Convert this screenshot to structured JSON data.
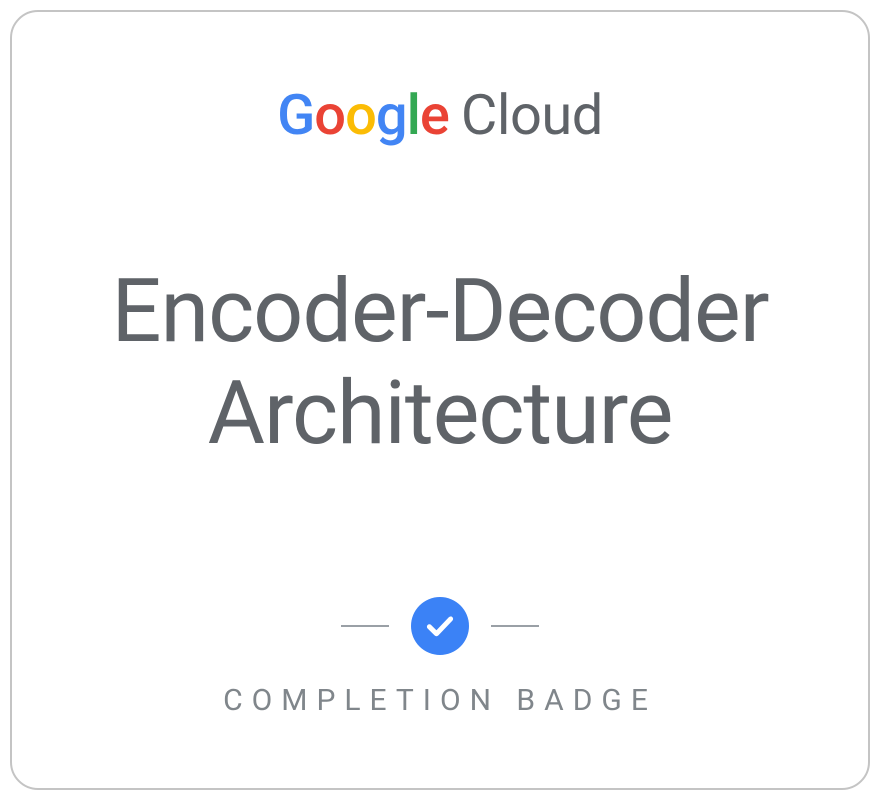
{
  "brand": {
    "google": {
      "g1": "G",
      "o1": "o",
      "o2": "o",
      "g2": "g",
      "l": "l",
      "e": "e"
    },
    "cloud": "Cloud"
  },
  "course": {
    "line1": "Encoder-Decoder",
    "line2": "Architecture"
  },
  "footer": {
    "label": "COMPLETION BADGE"
  },
  "colors": {
    "blue": "#4285F4",
    "red": "#EA4335",
    "yellow": "#FBBC05",
    "green": "#34A853",
    "gray": "#5f6368",
    "checkBg": "#3b82f6"
  }
}
